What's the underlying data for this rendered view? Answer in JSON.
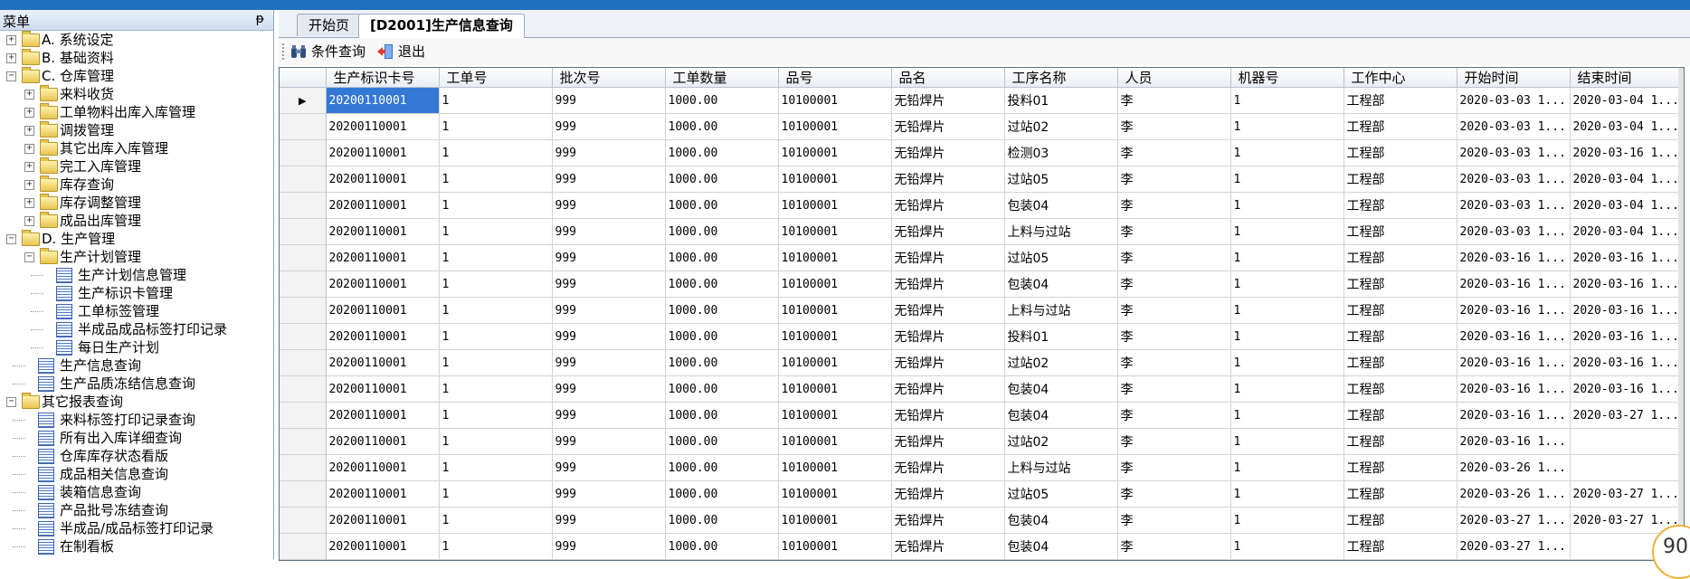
{
  "menu": {
    "title": "菜单",
    "pin": "ᵽ",
    "items": [
      {
        "label": "A. 系统设定",
        "level": 0,
        "type": "folder",
        "expander": "+"
      },
      {
        "label": "B. 基础资料",
        "level": 0,
        "type": "folder",
        "expander": "+"
      },
      {
        "label": "C. 仓库管理",
        "level": 0,
        "type": "folder",
        "expander": "−"
      },
      {
        "label": "来料收货",
        "level": 1,
        "type": "folder",
        "expander": "+"
      },
      {
        "label": "工单物料出库入库管理",
        "level": 1,
        "type": "folder",
        "expander": "+"
      },
      {
        "label": "调拨管理",
        "level": 1,
        "type": "folder",
        "expander": "+"
      },
      {
        "label": "其它出库入库管理",
        "level": 1,
        "type": "folder",
        "expander": "+"
      },
      {
        "label": "完工入库管理",
        "level": 1,
        "type": "folder",
        "expander": "+"
      },
      {
        "label": "库存查询",
        "level": 1,
        "type": "folder",
        "expander": "+"
      },
      {
        "label": "库存调整管理",
        "level": 1,
        "type": "folder",
        "expander": "+"
      },
      {
        "label": "成品出库管理",
        "level": 1,
        "type": "folder",
        "expander": "+"
      },
      {
        "label": "D. 生产管理",
        "level": 0,
        "type": "folder",
        "expander": "−"
      },
      {
        "label": "生产计划管理",
        "level": 1,
        "type": "folder",
        "expander": "−"
      },
      {
        "label": "生产计划信息管理",
        "level": 2,
        "type": "doc",
        "expander": ""
      },
      {
        "label": "生产标识卡管理",
        "level": 2,
        "type": "doc",
        "expander": ""
      },
      {
        "label": "工单标签管理",
        "level": 2,
        "type": "doc",
        "expander": ""
      },
      {
        "label": "半成品成品标签打印记录",
        "level": 2,
        "type": "doc",
        "expander": ""
      },
      {
        "label": "每日生产计划",
        "level": 2,
        "type": "doc",
        "expander": ""
      },
      {
        "label": "生产信息查询",
        "level": 1,
        "type": "doc",
        "expander": ""
      },
      {
        "label": "生产品质冻结信息查询",
        "level": 1,
        "type": "doc",
        "expander": ""
      },
      {
        "label": "其它报表查询",
        "level": 0,
        "type": "folder",
        "expander": "−"
      },
      {
        "label": "来料标签打印记录查询",
        "level": 1,
        "type": "doc",
        "expander": ""
      },
      {
        "label": "所有出入库详细查询",
        "level": 1,
        "type": "doc",
        "expander": ""
      },
      {
        "label": "仓库库存状态看版",
        "level": 1,
        "type": "doc",
        "expander": ""
      },
      {
        "label": "成品相关信息查询",
        "level": 1,
        "type": "doc",
        "expander": ""
      },
      {
        "label": "装箱信息查询",
        "level": 1,
        "type": "doc",
        "expander": ""
      },
      {
        "label": "产品批号冻结查询",
        "level": 1,
        "type": "doc",
        "expander": ""
      },
      {
        "label": "半成品/成品标签打印记录",
        "level": 1,
        "type": "doc",
        "expander": ""
      },
      {
        "label": "在制看板",
        "level": 1,
        "type": "doc",
        "expander": ""
      }
    ]
  },
  "tabs": {
    "start": "开始页",
    "active": "[D2001]生产信息查询"
  },
  "toolbar": {
    "query_label": "条件查询",
    "exit_label": "退出"
  },
  "grid": {
    "columns": [
      "生产标识卡号",
      "工单号",
      "批次号",
      "工单数量",
      "品号",
      "品名",
      "工序名称",
      "人员",
      "机器号",
      "工作中心",
      "开始时间",
      "结束时间"
    ],
    "current_row_marker": "▶",
    "rows": [
      [
        "20200110001",
        "1",
        "999",
        "1000.00",
        "10100001",
        "无铅焊片",
        "投料01",
        "李",
        "1",
        "工程部",
        "2020-03-03 1...",
        "2020-03-04 1..."
      ],
      [
        "20200110001",
        "1",
        "999",
        "1000.00",
        "10100001",
        "无铅焊片",
        "过站02",
        "李",
        "1",
        "工程部",
        "2020-03-03 1...",
        "2020-03-04 1..."
      ],
      [
        "20200110001",
        "1",
        "999",
        "1000.00",
        "10100001",
        "无铅焊片",
        "检测03",
        "李",
        "1",
        "工程部",
        "2020-03-03 1...",
        "2020-03-16 1..."
      ],
      [
        "20200110001",
        "1",
        "999",
        "1000.00",
        "10100001",
        "无铅焊片",
        "过站05",
        "李",
        "1",
        "工程部",
        "2020-03-03 1...",
        "2020-03-04 1..."
      ],
      [
        "20200110001",
        "1",
        "999",
        "1000.00",
        "10100001",
        "无铅焊片",
        "包装04",
        "李",
        "1",
        "工程部",
        "2020-03-03 1...",
        "2020-03-04 1..."
      ],
      [
        "20200110001",
        "1",
        "999",
        "1000.00",
        "10100001",
        "无铅焊片",
        "上料与过站",
        "李",
        "1",
        "工程部",
        "2020-03-03 1...",
        "2020-03-04 1..."
      ],
      [
        "20200110001",
        "1",
        "999",
        "1000.00",
        "10100001",
        "无铅焊片",
        "过站05",
        "李",
        "1",
        "工程部",
        "2020-03-16 1...",
        "2020-03-16 1..."
      ],
      [
        "20200110001",
        "1",
        "999",
        "1000.00",
        "10100001",
        "无铅焊片",
        "包装04",
        "李",
        "1",
        "工程部",
        "2020-03-16 1...",
        "2020-03-16 1..."
      ],
      [
        "20200110001",
        "1",
        "999",
        "1000.00",
        "10100001",
        "无铅焊片",
        "上料与过站",
        "李",
        "1",
        "工程部",
        "2020-03-16 1...",
        "2020-03-16 1..."
      ],
      [
        "20200110001",
        "1",
        "999",
        "1000.00",
        "10100001",
        "无铅焊片",
        "投料01",
        "李",
        "1",
        "工程部",
        "2020-03-16 1...",
        "2020-03-16 1..."
      ],
      [
        "20200110001",
        "1",
        "999",
        "1000.00",
        "10100001",
        "无铅焊片",
        "过站02",
        "李",
        "1",
        "工程部",
        "2020-03-16 1...",
        "2020-03-16 1..."
      ],
      [
        "20200110001",
        "1",
        "999",
        "1000.00",
        "10100001",
        "无铅焊片",
        "包装04",
        "李",
        "1",
        "工程部",
        "2020-03-16 1...",
        "2020-03-16 1..."
      ],
      [
        "20200110001",
        "1",
        "999",
        "1000.00",
        "10100001",
        "无铅焊片",
        "包装04",
        "李",
        "1",
        "工程部",
        "2020-03-16 1...",
        "2020-03-27 1..."
      ],
      [
        "20200110001",
        "1",
        "999",
        "1000.00",
        "10100001",
        "无铅焊片",
        "过站02",
        "李",
        "1",
        "工程部",
        "2020-03-16 1...",
        ""
      ],
      [
        "20200110001",
        "1",
        "999",
        "1000.00",
        "10100001",
        "无铅焊片",
        "上料与过站",
        "李",
        "1",
        "工程部",
        "2020-03-26 1...",
        ""
      ],
      [
        "20200110001",
        "1",
        "999",
        "1000.00",
        "10100001",
        "无铅焊片",
        "过站05",
        "李",
        "1",
        "工程部",
        "2020-03-26 1...",
        "2020-03-27 1..."
      ],
      [
        "20200110001",
        "1",
        "999",
        "1000.00",
        "10100001",
        "无铅焊片",
        "包装04",
        "李",
        "1",
        "工程部",
        "2020-03-27 1...",
        "2020-03-27 1..."
      ],
      [
        "20200110001",
        "1",
        "999",
        "1000.00",
        "10100001",
        "无铅焊片",
        "包装04",
        "李",
        "1",
        "工程部",
        "2020-03-27 1...",
        ""
      ]
    ]
  },
  "corner_badge": "90",
  "colors": {
    "title_bar": "#1f6fbf",
    "selection": "#3478d6",
    "badge_border": "#f0b03c"
  }
}
